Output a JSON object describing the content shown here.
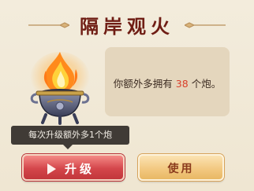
{
  "dialog": {
    "title": "隔岸观火",
    "info_prefix": "你额外多拥有",
    "count": "38",
    "info_suffix": "个炮。"
  },
  "tooltip": {
    "text": "每次升级额外多1个炮"
  },
  "buttons": {
    "upgrade_label": "升级",
    "use_label": "使用"
  },
  "icon": "flaming-cauldron-icon",
  "colors": {
    "title": "#6f1d14",
    "count": "#d9402b",
    "upgrade_button": "#d4464b",
    "use_button": "#f2c77e"
  }
}
